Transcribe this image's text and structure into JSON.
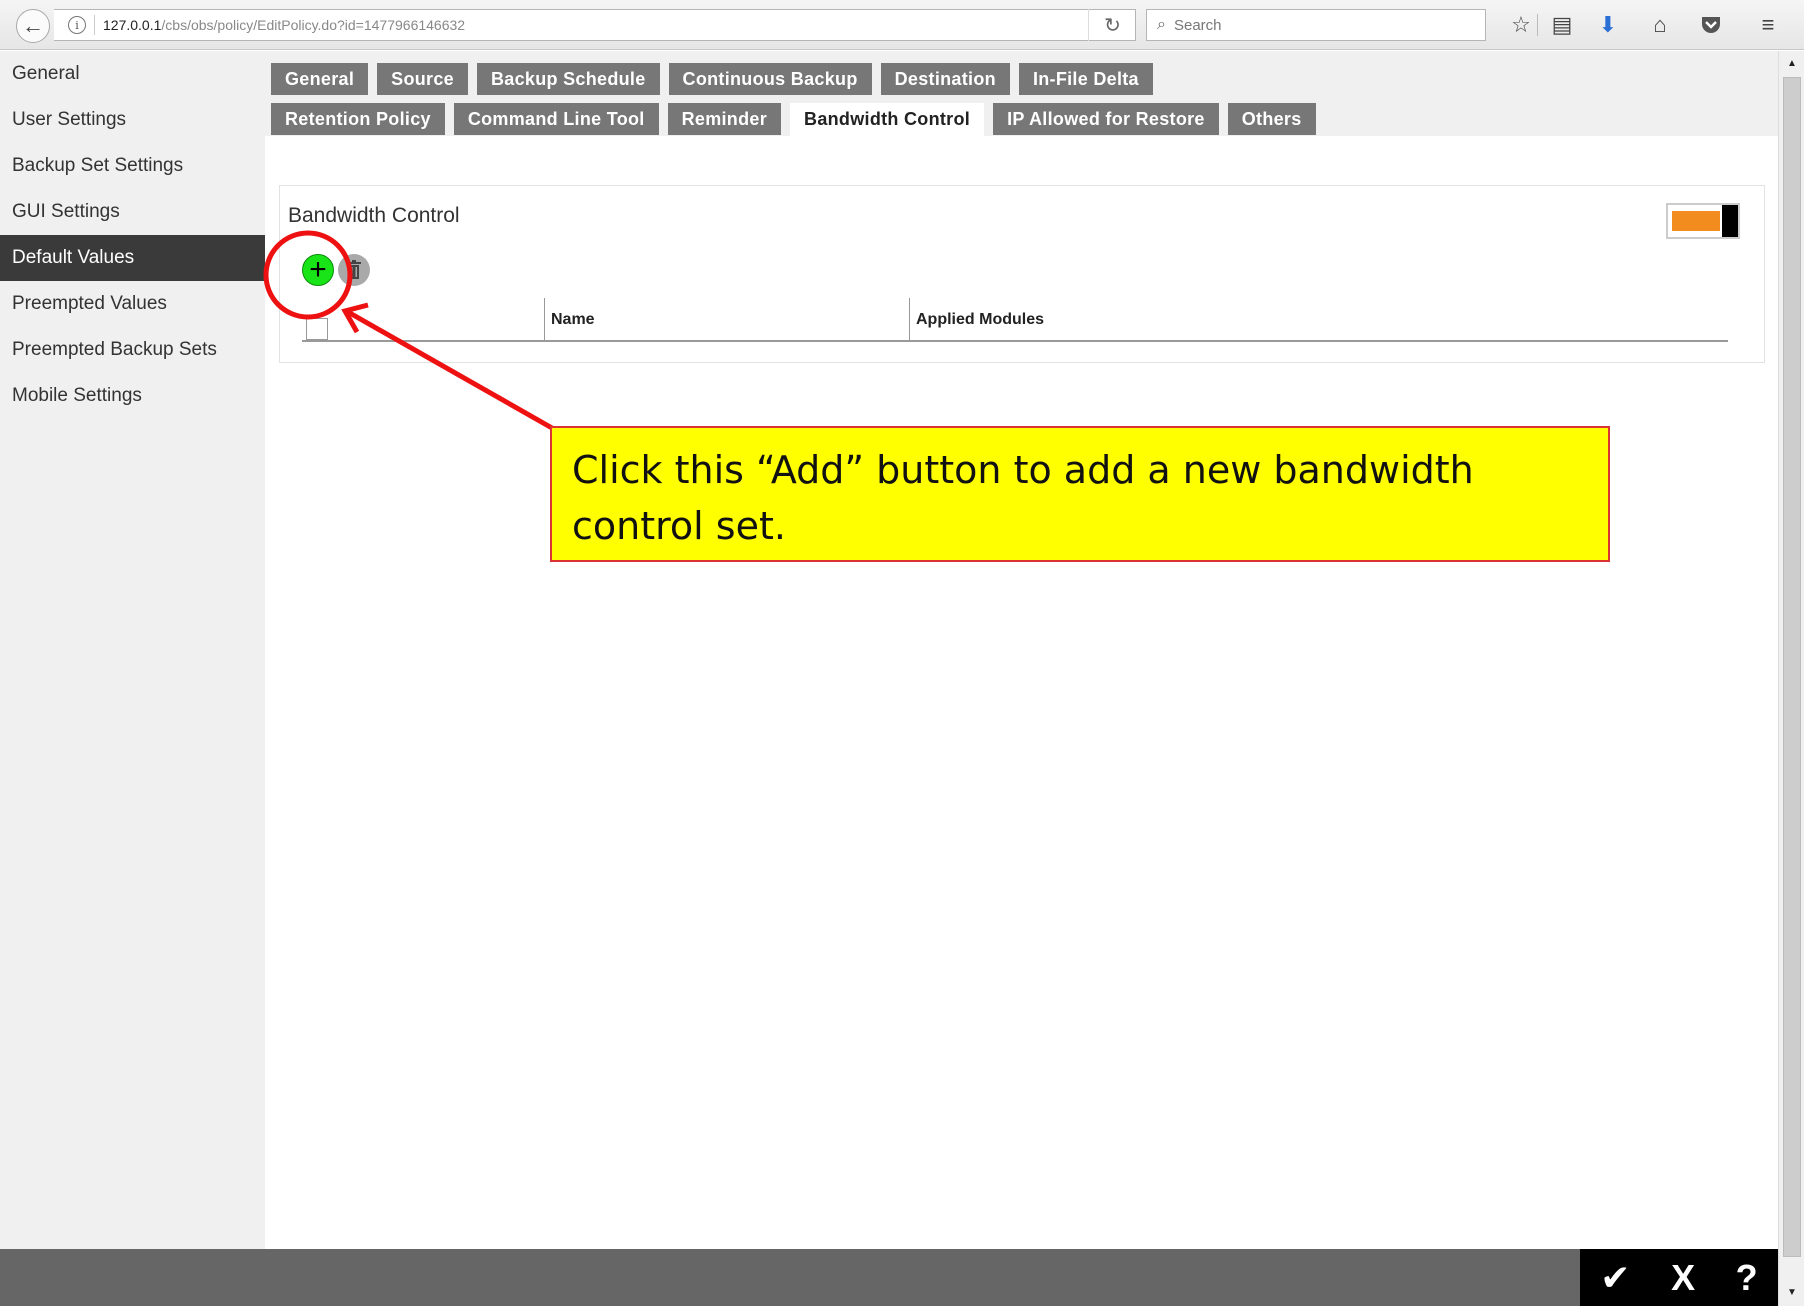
{
  "browser": {
    "url_host": "127.0.0.1",
    "url_path": "/cbs/obs/policy/EditPolicy.do?id=1477966146632",
    "search_placeholder": "Search",
    "icons": [
      "back-arrow-icon",
      "info-icon",
      "reload-icon",
      "search-icon",
      "bookmark-star-icon",
      "reading-list-icon",
      "download-icon",
      "home-icon",
      "pocket-icon",
      "menu-icon"
    ]
  },
  "sidebar": {
    "items": [
      {
        "label": "General"
      },
      {
        "label": "User Settings"
      },
      {
        "label": "Backup Set Settings"
      },
      {
        "label": "GUI Settings"
      },
      {
        "label": "Default Values",
        "active": true
      },
      {
        "label": "Preempted Values"
      },
      {
        "label": "Preempted Backup Sets"
      },
      {
        "label": "Mobile Settings"
      }
    ]
  },
  "tabs": {
    "row1": [
      "General",
      "Source",
      "Backup Schedule",
      "Continuous Backup",
      "Destination",
      "In-File Delta"
    ],
    "row2": [
      "Retention Policy",
      "Command Line Tool",
      "Reminder",
      "Bandwidth Control",
      "IP Allowed for Restore",
      "Others"
    ],
    "active": "Bandwidth Control"
  },
  "panel": {
    "title": "Bandwidth Control",
    "toggle_on": true,
    "columns": [
      "Name",
      "Applied Modules"
    ]
  },
  "footer": {
    "ok_symbol": "✔",
    "cancel_symbol": "X",
    "help_symbol": "?"
  },
  "annotation": {
    "text": "Click this “Add” button to add a new bandwidth control set."
  },
  "colors": {
    "tab_bg": "#777777",
    "active_sidebar": "#3a3a3a",
    "add_button": "#18e418",
    "toggle_orange": "#f28c1f",
    "callout_bg": "#ffff00",
    "annotation_red": "#ee1111"
  }
}
